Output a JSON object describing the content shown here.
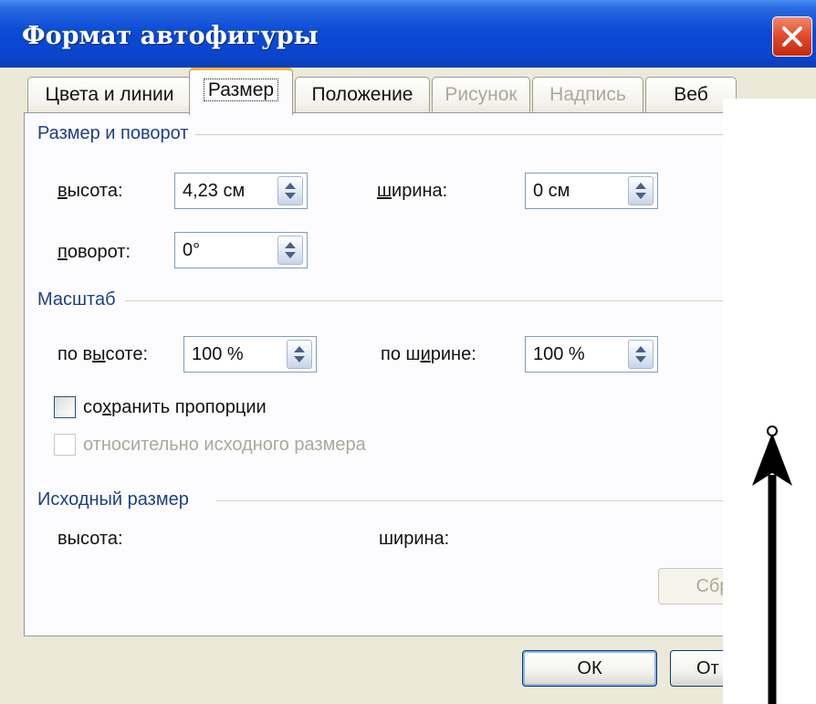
{
  "window": {
    "title": "Формат автофигуры",
    "close_label": "close"
  },
  "tabs": [
    {
      "label": "Цвета и линии",
      "state": "normal"
    },
    {
      "label": "Размер",
      "state": "active"
    },
    {
      "label": "Положение",
      "state": "normal"
    },
    {
      "label": "Рисунок",
      "state": "disabled"
    },
    {
      "label": "Надпись",
      "state": "disabled"
    },
    {
      "label": "Веб",
      "state": "normal"
    }
  ],
  "size_rotate": {
    "title": "Размер и поворот",
    "height": {
      "pre": "",
      "ul": "в",
      "post": "ысота:",
      "value": "4,23 см"
    },
    "width": {
      "pre": "",
      "ul": "ш",
      "post": "ирина:",
      "value": "0 см"
    },
    "rotation": {
      "pre": "",
      "ul": "п",
      "post": "оворот:",
      "value": "0°"
    }
  },
  "scale": {
    "title": "Масштаб",
    "by_height": {
      "pre": "по в",
      "ul": "ы",
      "post": "соте:",
      "value": "100 %"
    },
    "by_width": {
      "pre": "по ш",
      "ul": "и",
      "post": "рине:",
      "value": "100 %"
    },
    "lock_aspect": {
      "pre": "со",
      "ul": "х",
      "post": "ранить пропорции",
      "checked": false
    },
    "relative_original": {
      "label": "относительно исходного размера",
      "checked": false,
      "disabled": true
    }
  },
  "original_size": {
    "title": "Исходный размер",
    "height_label": "высота:",
    "width_label": "ширина:",
    "reset_button": "Сбр"
  },
  "buttons": {
    "ok": "ОК",
    "cancel": "От"
  },
  "colors": {
    "titlebar": "#0a45cc",
    "group_title": "#1e3f86",
    "active_tab_accent": "#f2b33d",
    "disabled_text": "#aca899"
  },
  "icons": {
    "close": "close-icon",
    "spinner": "spin-updown-icon",
    "annotation": "arrow-up-icon"
  }
}
